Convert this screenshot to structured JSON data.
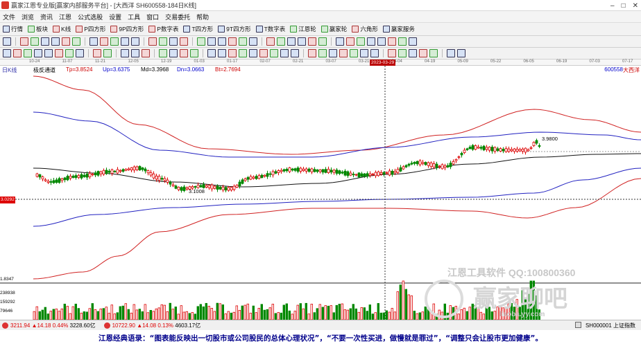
{
  "window": {
    "title": "赢家江恩专业版[赢家内部服务平台] - [大西洋  SH600558-184日K线]"
  },
  "menu": [
    "文件",
    "浏览",
    "资讯",
    "江恩",
    "公式选股",
    "设置",
    "工具",
    "窗口",
    "交易委托",
    "帮助"
  ],
  "toolbar1": [
    "行情",
    "板块",
    "K线",
    "P四方形",
    "9P四方形",
    "P数字表",
    "T四方形",
    "9T四方形",
    "T数字表",
    "江恩轮",
    "赢家轮",
    "六角形",
    "赢家服务"
  ],
  "chart": {
    "period_label": "日K线",
    "dates": [
      "10-24",
      "11-07",
      "11-21",
      "12-05",
      "12-19",
      "01-03",
      "01-17",
      "02-07",
      "02-21",
      "03-07",
      "03-21",
      "04-04",
      "04-19",
      "05-09",
      "05-22",
      "06-05",
      "06-19",
      "07-03",
      "07-17"
    ],
    "cursor_date": "2023-03-29",
    "indicator": {
      "name": "极反通道",
      "tp": "Tp=3.8524",
      "up": "Up=3.6375",
      "md": "Md=3.3968",
      "dn": "Dn=3.0663",
      "bt": "Bt=2.7694"
    },
    "stock_code": "600558",
    "stock_name": "大西洋",
    "price_tag": "3.0292",
    "high_label": "3.9800",
    "low_label": "3.1008",
    "volume_axis": [
      "1.8347",
      "238938",
      "159292",
      "79646"
    ],
    "watermark_line1": "江恩工具软件  QQ:100800360",
    "watermark_line2": "赢家聊吧",
    "watermark_line3": "liaoba.yy.com"
  },
  "colors": {
    "up": "#dd0000",
    "down": "#008800",
    "channel_outer": "#d02020",
    "channel_inner": "#2020c0",
    "mid": "#111111"
  },
  "status": {
    "sh_index": "3211.94",
    "sh_change": "▲14.18",
    "sh_pct": "0.44%",
    "sh_amount": "3228.60亿",
    "sz_index": "10722.90",
    "sz_change": "▲14.08",
    "sz_pct": "0.13%",
    "sz_amount": "4603.17亿",
    "right_label": "SH000001 上证指数"
  },
  "quote": "江恩经典语录：“图表能反映出一切股市或公司股民的总体心理状况”，“不要一次性买进，做慢就是罪过”，“调整只会让股市更加健康”。"
}
